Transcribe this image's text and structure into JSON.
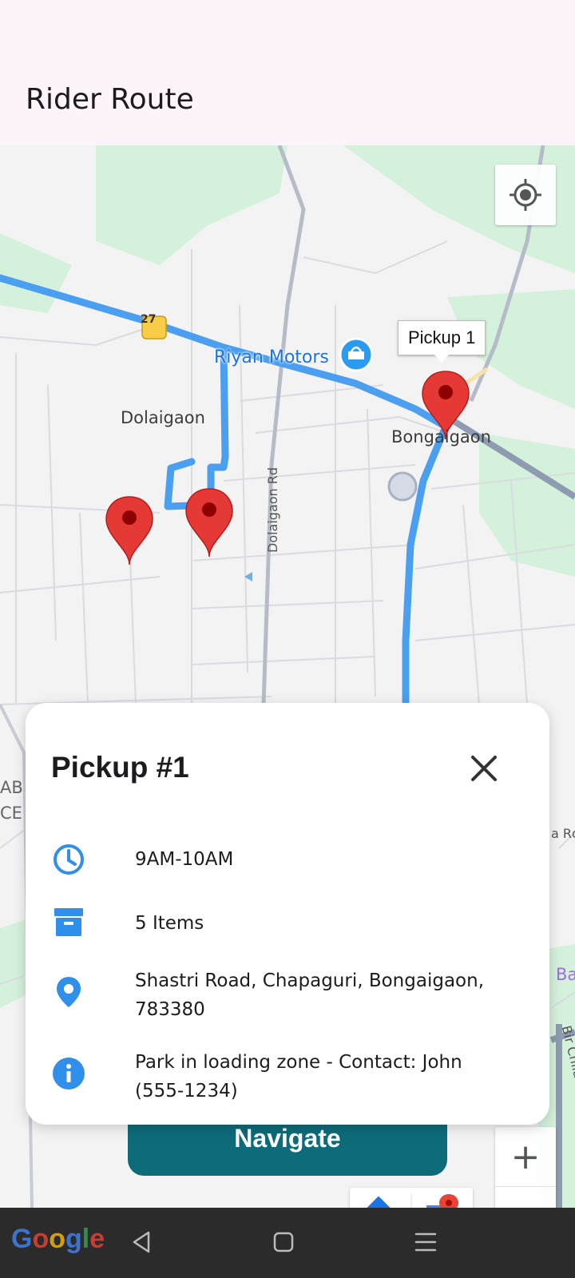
{
  "app_bar": {
    "title": "Rider Route"
  },
  "map": {
    "route_color": "#4a9ff0",
    "labels": {
      "dolaigaon": "Dolaigaon",
      "bongaigaon": "Bongaigaon",
      "riyan_motors": "Riyan Motors",
      "dolaigaon_rd": "Dolaigaon Rd",
      "highway_number": "27",
      "edge_left_1": "AB",
      "edge_left_2": "CE",
      "edge_right_rd": "a Rd",
      "edge_right_ba": "Ba",
      "edge_right_road": "Bir Chilarai Ro"
    },
    "marker_tooltip": "Pickup 1",
    "marker_color": "#e53935",
    "attribution": [
      "G",
      "o",
      "o",
      "g",
      "l",
      "e"
    ]
  },
  "card": {
    "title": "Pickup #1",
    "rows": [
      {
        "icon": "clock-icon",
        "text": "9AM-10AM"
      },
      {
        "icon": "archive-box-icon",
        "text": "5 Items"
      },
      {
        "icon": "location-pin-icon",
        "text": "Shastri Road, Chapaguri, Bongaigaon, 783380"
      },
      {
        "icon": "info-icon",
        "text": "Park in loading zone - Contact: John (555-1234)"
      }
    ],
    "icon_color": "#2f8fea"
  },
  "navigate_button": {
    "label": "Navigate",
    "color": "#0e6b7a"
  },
  "zoom": {
    "in_label": "+",
    "out_label": "−"
  }
}
